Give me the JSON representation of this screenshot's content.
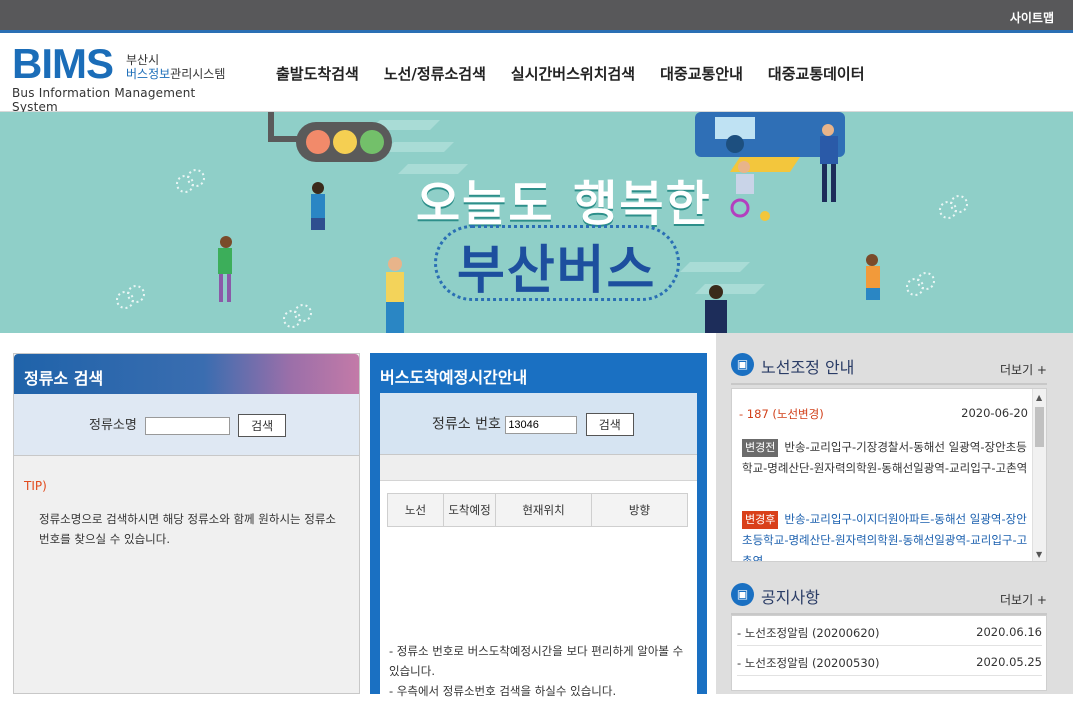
{
  "topbar": {
    "sitemap": "사이트맵"
  },
  "logo": {
    "mark": "BIMS",
    "line1": "부산시",
    "line2_highlight": "버스정보",
    "line2_rest": "관리시스템",
    "english": "Bus Information Management System"
  },
  "nav": [
    "출발도착검색",
    "노선/정류소검색",
    "실시간버스위치검색",
    "대중교통안내",
    "대중교통데이터"
  ],
  "banner": {
    "line1": "오늘도 행복한",
    "line2": "부산버스"
  },
  "stop_search": {
    "title": "정류소 검색",
    "label": "정류소명",
    "value": "",
    "button": "검색",
    "tip_title": "TIP)",
    "tip_body": "정류소명으로 검색하시면 해당 정류소와 함께 원하시는 정류소 번호를 찾으실 수 있습니다."
  },
  "arrival": {
    "title": "버스도착예정시간안내",
    "label": "정류소 번호",
    "value": "13046",
    "button": "검색",
    "columns": [
      "노선",
      "도착예정",
      "현재위치",
      "방향"
    ],
    "notes": [
      "- 정류소 번호로 버스도착예정시간을 보다 편리하게 알아볼 수 있습니다.",
      "- 우측에서 정류소번호 검색을 하실수 있습니다."
    ]
  },
  "route_change": {
    "title": "노선조정 안내",
    "more": "더보기 +",
    "item_title": "- 187 (노선변경)",
    "item_date": "2020-06-20",
    "before_tag": "변경전",
    "before_text": "반송-교리입구-기장경찰서-동해선 일광역-장안초등학교-명례산단-원자력의학원-동해선일광역-교리입구-고촌역",
    "after_tag": "변경후",
    "after_text": "반송-교리입구-이지더원아파트-동해선 일광역-장안초등학교-명례산단-원자력의학원-동해선일광역-교리입구-고촌역"
  },
  "notice": {
    "title": "공지사항",
    "more": "더보기 +",
    "items": [
      {
        "title": "- 노선조정알림 (20200620)",
        "date": "2020.06.16"
      },
      {
        "title": "- 노선조정알림 (20200530)",
        "date": "2020.05.25"
      }
    ]
  },
  "colors": {
    "brand_blue": "#1a70c2",
    "topbar": "#58585a",
    "banner": "#8fcfc8",
    "alert_red": "#d9401a"
  }
}
